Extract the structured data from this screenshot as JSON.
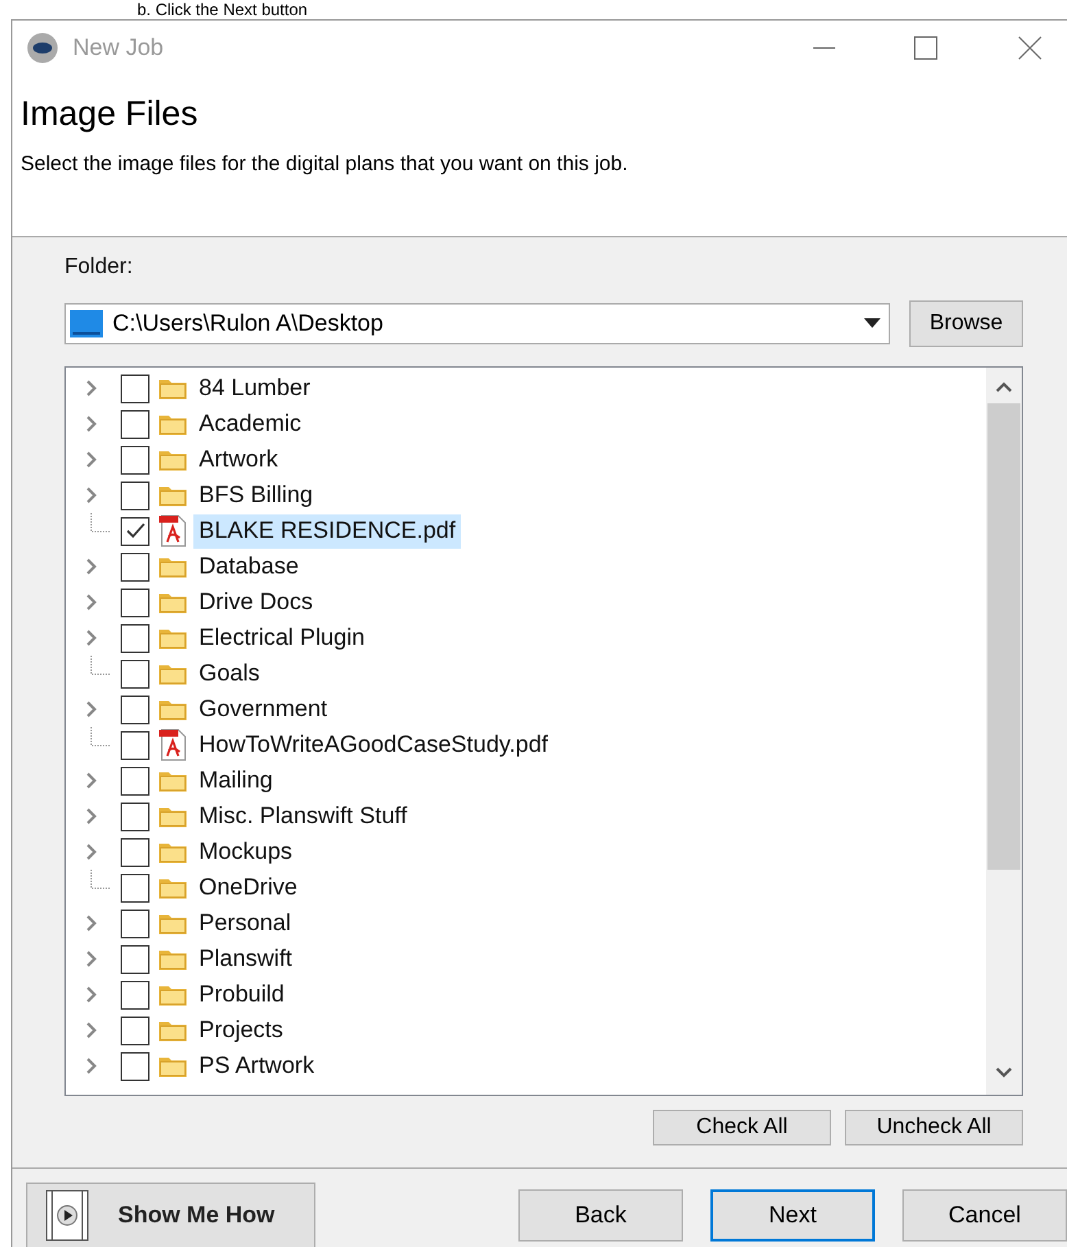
{
  "doc_caption": "b.  Click the Next button",
  "window": {
    "title": "New Job"
  },
  "header": {
    "title": "Image Files",
    "description": "Select the image files for the digital plans that you want on this job."
  },
  "folder": {
    "label": "Folder:",
    "value": "C:\\Users\\Rulon A\\Desktop",
    "browse": "Browse"
  },
  "tree": [
    {
      "kind": "folder",
      "label": "84 Lumber",
      "expandable": true,
      "checked": false,
      "selected": false
    },
    {
      "kind": "folder",
      "label": "Academic",
      "expandable": true,
      "checked": false,
      "selected": false
    },
    {
      "kind": "folder",
      "label": "Artwork",
      "expandable": true,
      "checked": false,
      "selected": false
    },
    {
      "kind": "folder",
      "label": "BFS Billing",
      "expandable": true,
      "checked": false,
      "selected": false
    },
    {
      "kind": "pdf",
      "label": "BLAKE RESIDENCE.pdf",
      "expandable": false,
      "checked": true,
      "selected": true
    },
    {
      "kind": "folder",
      "label": "Database",
      "expandable": true,
      "checked": false,
      "selected": false
    },
    {
      "kind": "folder",
      "label": "Drive Docs",
      "expandable": true,
      "checked": false,
      "selected": false
    },
    {
      "kind": "folder",
      "label": "Electrical Plugin",
      "expandable": true,
      "checked": false,
      "selected": false
    },
    {
      "kind": "folder",
      "label": "Goals",
      "expandable": false,
      "checked": false,
      "selected": false
    },
    {
      "kind": "folder",
      "label": "Government",
      "expandable": true,
      "checked": false,
      "selected": false
    },
    {
      "kind": "pdf",
      "label": "HowToWriteAGoodCaseStudy.pdf",
      "expandable": false,
      "checked": false,
      "selected": false
    },
    {
      "kind": "folder",
      "label": "Mailing",
      "expandable": true,
      "checked": false,
      "selected": false
    },
    {
      "kind": "folder",
      "label": "Misc. Planswift Stuff",
      "expandable": true,
      "checked": false,
      "selected": false
    },
    {
      "kind": "folder",
      "label": "Mockups",
      "expandable": true,
      "checked": false,
      "selected": false
    },
    {
      "kind": "folder",
      "label": "OneDrive",
      "expandable": false,
      "checked": false,
      "selected": false
    },
    {
      "kind": "folder",
      "label": "Personal",
      "expandable": true,
      "checked": false,
      "selected": false
    },
    {
      "kind": "folder",
      "label": "Planswift",
      "expandable": true,
      "checked": false,
      "selected": false
    },
    {
      "kind": "folder",
      "label": "Probuild",
      "expandable": true,
      "checked": false,
      "selected": false
    },
    {
      "kind": "folder",
      "label": "Projects",
      "expandable": true,
      "checked": false,
      "selected": false
    },
    {
      "kind": "folder",
      "label": "PS Artwork",
      "expandable": true,
      "checked": false,
      "selected": false
    }
  ],
  "list_buttons": [
    "Check All",
    "Uncheck All"
  ],
  "footer": {
    "help": "Show Me How",
    "buttons": [
      {
        "label": "Back",
        "selected": false
      },
      {
        "label": "Next",
        "selected": true
      },
      {
        "label": "Cancel",
        "selected": false
      }
    ]
  }
}
